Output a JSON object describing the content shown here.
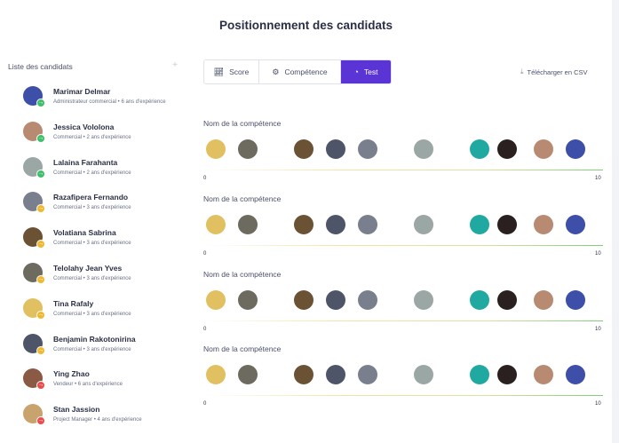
{
  "page_title": "Positionnement des candidats",
  "sidebar": {
    "title": "Liste des candidats",
    "add_icon": "plus-icon",
    "candidates": [
      {
        "name": "Marimar Delmar",
        "subtitle": "Administrateur commercial • 6 ans d'expérience",
        "status": "green",
        "avatar_color": "#3d4fa8"
      },
      {
        "name": "Jessica Vololona",
        "subtitle": "Commercial • 2 ans d'expérience",
        "status": "green",
        "avatar_color": "#b98a72"
      },
      {
        "name": "Lalaina Farahanta",
        "subtitle": "Commercial • 2 ans d'expérience",
        "status": "green",
        "avatar_color": "#9aa7a4"
      },
      {
        "name": "Razafipera Fernando",
        "subtitle": "Commercial • 3 ans d'expérience",
        "status": "yellow",
        "avatar_color": "#7a7f8d"
      },
      {
        "name": "Volatiana Sabrina",
        "subtitle": "Commercial • 3 ans d'expérience",
        "status": "yellow",
        "avatar_color": "#6b5234"
      },
      {
        "name": "Telolahy Jean Yves",
        "subtitle": "Commercial • 3 ans d'expérience",
        "status": "yellow",
        "avatar_color": "#6d6a60"
      },
      {
        "name": "Tina Rafaly",
        "subtitle": "Commercial • 3 ans d'expérience",
        "status": "yellow",
        "avatar_color": "#e0c060"
      },
      {
        "name": "Benjamin Rakotonirina",
        "subtitle": "Commercial • 3 ans d'expérience",
        "status": "yellow",
        "avatar_color": "#4e5568"
      },
      {
        "name": "Ying Zhao",
        "subtitle": "Vendeur • 6 ans d'expérience",
        "status": "red",
        "avatar_color": "#8a5a44"
      },
      {
        "name": "Stan Jassion",
        "subtitle": "Project Manager • 4 ans d'expérience",
        "status": "red",
        "avatar_color": "#c9a36e"
      }
    ]
  },
  "tabs": [
    {
      "label": "Score",
      "icon": "line-chart-icon",
      "active": false
    },
    {
      "label": "Compétence",
      "icon": "user-gear-icon",
      "active": false
    },
    {
      "label": "Test",
      "icon": "gauge-icon",
      "active": true
    }
  ],
  "download_csv": {
    "label": "Télécharger en CSV",
    "icon": "download-icon"
  },
  "axis": {
    "min": "0",
    "max": "10"
  },
  "skills": [
    {
      "title": "Nom de la compétence"
    },
    {
      "title": "Nom de la compétence"
    },
    {
      "title": "Nom de la compétence"
    },
    {
      "title": "Nom de la compétence"
    }
  ],
  "colors": {
    "accent": "#5b34d6",
    "green": "#3fbf6a",
    "yellow": "#f2b82d",
    "red": "#ec4b4b"
  },
  "positioned_avatars": [
    {
      "score": 0.3,
      "color": "#e0c060"
    },
    {
      "score": 1.1,
      "color": "#6d6a60"
    },
    {
      "score": 2.5,
      "color": "#6b5234"
    },
    {
      "score": 3.3,
      "color": "#4e5568"
    },
    {
      "score": 4.1,
      "color": "#7a7f8d"
    },
    {
      "score": 5.5,
      "color": "#9aa7a4"
    },
    {
      "score": 6.9,
      "color": "#1fa9a0"
    },
    {
      "score": 7.6,
      "color": "#2a2020"
    },
    {
      "score": 8.5,
      "color": "#b98a72"
    },
    {
      "score": 9.3,
      "color": "#3d4fa8"
    }
  ]
}
